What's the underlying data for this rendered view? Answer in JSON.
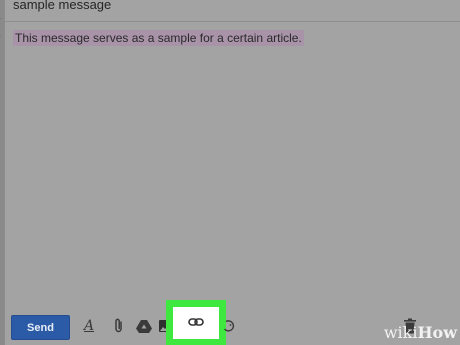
{
  "compose": {
    "subject": "sample message",
    "body_text": "This message serves as a sample for a certain article."
  },
  "toolbar": {
    "send_label": "Send",
    "icons": [
      "formatting-icon",
      "attach-icon",
      "drive-icon",
      "photo-icon",
      "link-icon",
      "emoji-icon",
      "trash-icon"
    ]
  },
  "highlight": {
    "color": "#3ee83e",
    "target": "link-icon"
  },
  "watermark": {
    "wiki": "wiki",
    "how": "How"
  },
  "colors": {
    "send": "#2b5ba6",
    "selection": "#a893a8"
  }
}
